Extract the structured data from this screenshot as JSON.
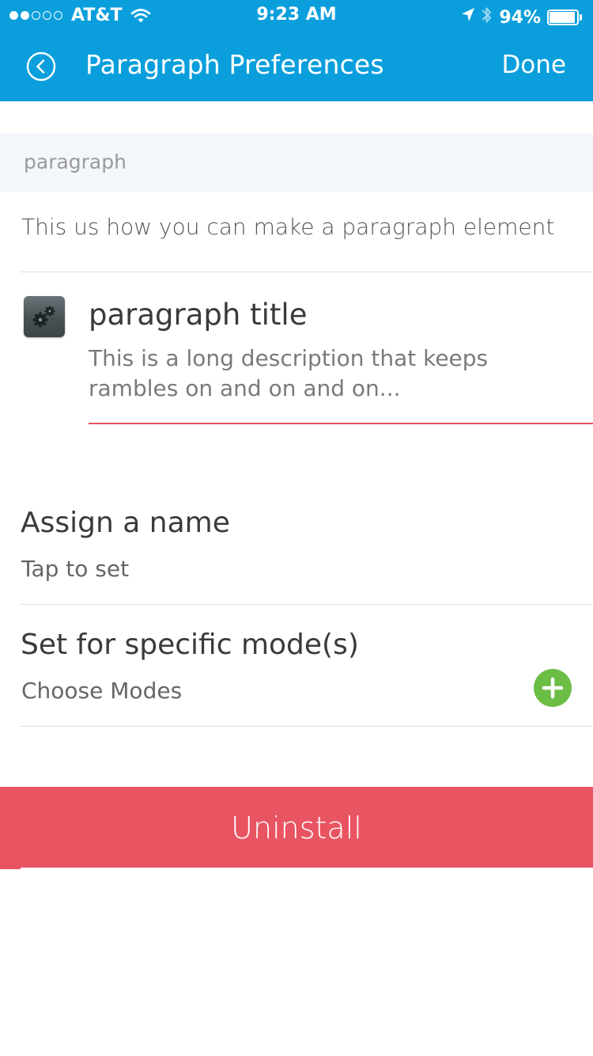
{
  "status_bar": {
    "signal_filled": 2,
    "signal_total": 5,
    "carrier": "AT&T",
    "time": "9:23 AM",
    "battery_percent": "94%",
    "battery_level": 0.94,
    "icons": [
      "wifi-icon",
      "location-arrow-icon",
      "bluetooth-icon",
      "battery-icon"
    ]
  },
  "nav": {
    "title": "Paragraph Preferences",
    "done_label": "Done",
    "back_icon": "back-circle-icon"
  },
  "section": {
    "header": "paragraph",
    "description": "This us how you can make a paragraph element"
  },
  "paragraph": {
    "icon": "gear-icon",
    "title": "paragraph title",
    "description": "This is a long description that keeps rambles on and on and on..."
  },
  "settings": {
    "name": {
      "title": "Assign a name",
      "value": "Tap to set"
    },
    "modes": {
      "title": "Set for specific mode(s)",
      "value": "Choose Modes",
      "add_icon": "plus-circle-icon"
    }
  },
  "uninstall_label": "Uninstall",
  "colors": {
    "header_blue": "#0a9fdc",
    "section_header_bg": "#f3f7fc",
    "accent_red": "#e95462",
    "add_green": "#6cbd45",
    "text_dark": "#3a3a3a"
  }
}
